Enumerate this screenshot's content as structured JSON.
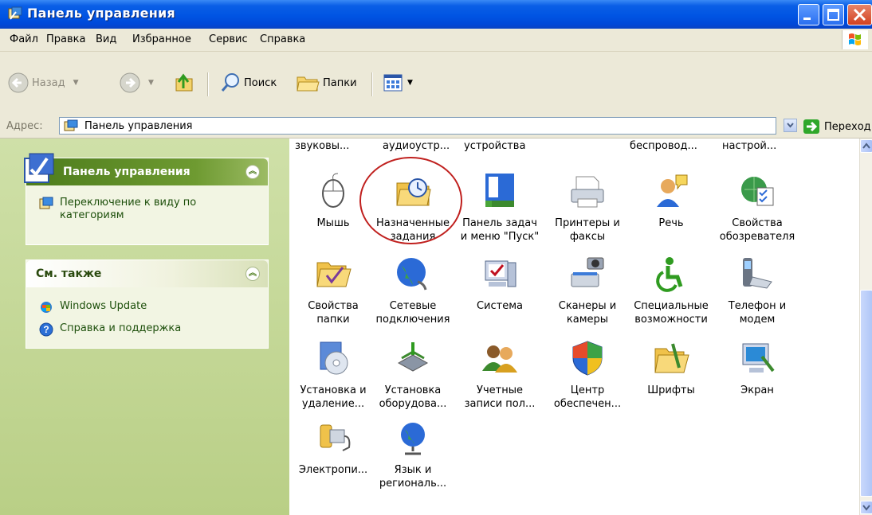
{
  "window": {
    "title": "Панель управления"
  },
  "menu": [
    {
      "label": "Файл"
    },
    {
      "label": "Правка"
    },
    {
      "label": "Вид"
    },
    {
      "label": "Избранное"
    },
    {
      "label": "Сервис"
    },
    {
      "label": "Справка"
    }
  ],
  "toolbar": {
    "back": "Назад",
    "search": "Поиск",
    "folders": "Папки"
  },
  "address": {
    "label": "Адрес:",
    "value": "Панель управления",
    "go": "Переход"
  },
  "left": {
    "panel_box": {
      "title": "Панель управления",
      "link": "Переключение к виду по\nкатегориям"
    },
    "see_also": {
      "title": "См. также",
      "links": [
        "Windows Update",
        "Справка и поддержка"
      ]
    }
  },
  "top_cut_row": [
    "звуковы...",
    "аудиоустр...",
    "устройства",
    "беспровод...",
    "настрой..."
  ],
  "items": [
    {
      "label": "Мышь",
      "icon": "mouse-icon"
    },
    {
      "label": "Назначенные\nзадания",
      "icon": "scheduled-tasks-icon"
    },
    {
      "label": "Панель задач\nи меню \"Пуск\"",
      "icon": "taskbar-icon"
    },
    {
      "label": "Принтеры и\nфаксы",
      "icon": "printer-icon"
    },
    {
      "label": "Речь",
      "icon": "speech-icon"
    },
    {
      "label": "Свойства\nобозревателя",
      "icon": "internet-options-icon"
    },
    {
      "label": "Свойства\nпапки",
      "icon": "folder-options-icon"
    },
    {
      "label": "Сетевые\nподключения",
      "icon": "network-icon"
    },
    {
      "label": "Система",
      "icon": "system-icon"
    },
    {
      "label": "Сканеры и\nкамеры",
      "icon": "scanner-icon"
    },
    {
      "label": "Специальные\nвозможности",
      "icon": "accessibility-icon"
    },
    {
      "label": "Телефон и\nмодем",
      "icon": "phone-modem-icon"
    },
    {
      "label": "Установка и\nудаление...",
      "icon": "add-remove-programs-icon"
    },
    {
      "label": "Установка\nоборудова...",
      "icon": "add-hardware-icon"
    },
    {
      "label": "Учетные\nзаписи пол...",
      "icon": "user-accounts-icon"
    },
    {
      "label": "Центр\nобеспечен...",
      "icon": "security-center-icon"
    },
    {
      "label": "Шрифты",
      "icon": "fonts-icon"
    },
    {
      "label": "Экран",
      "icon": "display-icon"
    },
    {
      "label": "Электропи...",
      "icon": "power-icon"
    },
    {
      "label": "Язык и\nрегиональ...",
      "icon": "regional-icon"
    }
  ]
}
